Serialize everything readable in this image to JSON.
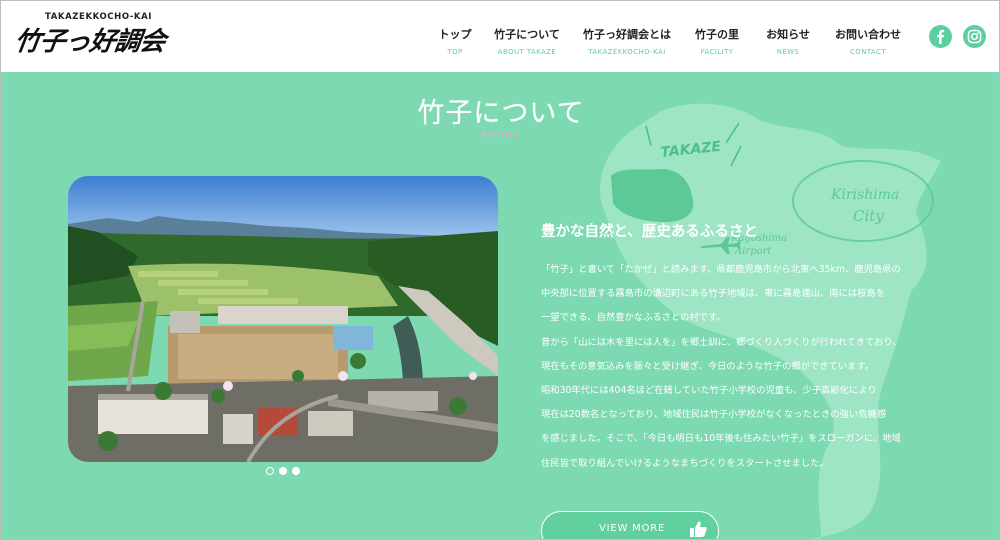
{
  "site": {
    "logo_sub": "TAKAZEKKOCHO-KAI",
    "logo_main": "竹子っ好調会"
  },
  "nav": [
    {
      "jp": "トップ",
      "en": "TOP"
    },
    {
      "jp": "竹子について",
      "en": "ABOUT TAKAZE"
    },
    {
      "jp": "竹子っ好調会とは",
      "en": "TAKAZEKKOCHO-KAI"
    },
    {
      "jp": "竹子の里",
      "en": "FACILITY"
    },
    {
      "jp": "お知らせ",
      "en": "NEWS"
    },
    {
      "jp": "お問い合わせ",
      "en": "CONTACT"
    }
  ],
  "sns": [
    {
      "icon": "facebook-icon"
    },
    {
      "icon": "instagram-icon"
    }
  ],
  "section": {
    "title": "竹子について",
    "subtitle": "ABOUT"
  },
  "map_labels": {
    "takaze": "TAKAZE",
    "kirishima": "Kirishima",
    "city": "City",
    "airport_1": "Kagoshima",
    "airport_2": "Airport"
  },
  "slider": {
    "count": 3,
    "active": 0
  },
  "content": {
    "lead": "豊かな自然と、歴史あるふるさと",
    "lines": [
      "「竹子」と書いて「たかぜ」と読みます。県都鹿児島市から北東へ35km、鹿児島県の",
      "中央部に位置する霧島市の溝辺町にある竹子地域は、東に霧島連山、南には桜島を",
      "一望できる、自然豊かなふるさとの村です。",
      "昔から「山には木を里には人を」を郷土訓に、郷づくり人づくりが行われてきており、",
      "現在もその意気込みを脈々と受け継ぎ、今日のような竹子の郷ができています。",
      "昭和30年代には404名ほど在籍していた竹子小学校の児童も、少子高齢化により",
      "現在は20数名となっており、地域住民は竹子小学校がなくなったときの強い危機感",
      "を感じました。そこで、「今日も明日も10年後も住みたい竹子」をスローガンに、地域",
      "住民皆で取り組んでいけるようなまちづくりをスタートさせました。"
    ],
    "button": "VIEW MORE"
  },
  "colors": {
    "background": "#7dd9b2",
    "accent": "#5ccf9f",
    "subtitle_pink": "#f2a6c6"
  }
}
